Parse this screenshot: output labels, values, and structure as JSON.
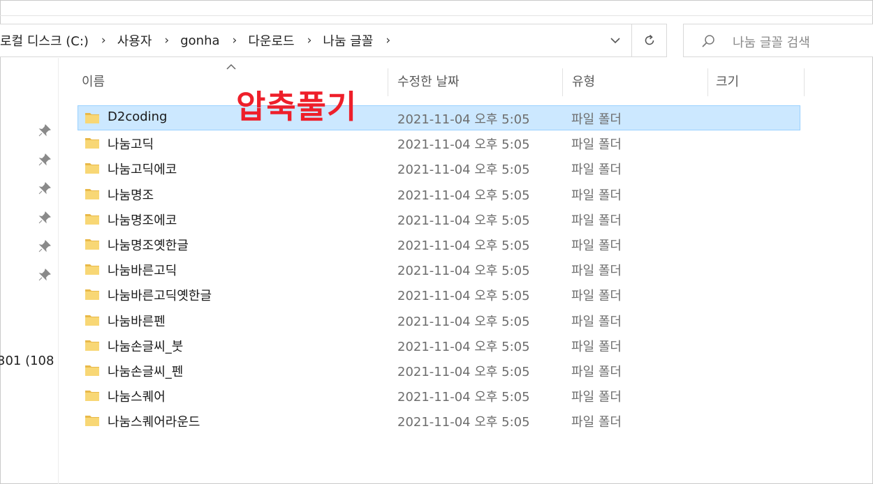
{
  "breadcrumb": {
    "items": [
      "로컬 디스크 (C:)",
      "사용자",
      "gonha",
      "다운로드",
      "나눔 글꼴"
    ]
  },
  "search": {
    "placeholder": "나눔 글꼴 검색"
  },
  "nav": {
    "truncated_item": "301 (108"
  },
  "columns": {
    "name": "이름",
    "date": "수정한 날짜",
    "type": "유형",
    "size": "크기"
  },
  "annotation": "압축풀기",
  "files": [
    {
      "name": "D2coding",
      "date": "2021-11-04 오후 5:05",
      "type": "파일 폴더",
      "selected": true
    },
    {
      "name": "나눔고딕",
      "date": "2021-11-04 오후 5:05",
      "type": "파일 폴더"
    },
    {
      "name": "나눔고딕에코",
      "date": "2021-11-04 오후 5:05",
      "type": "파일 폴더"
    },
    {
      "name": "나눔명조",
      "date": "2021-11-04 오후 5:05",
      "type": "파일 폴더"
    },
    {
      "name": "나눔명조에코",
      "date": "2021-11-04 오후 5:05",
      "type": "파일 폴더"
    },
    {
      "name": "나눔명조옛한글",
      "date": "2021-11-04 오후 5:05",
      "type": "파일 폴더"
    },
    {
      "name": "나눔바른고딕",
      "date": "2021-11-04 오후 5:05",
      "type": "파일 폴더"
    },
    {
      "name": "나눔바른고딕옛한글",
      "date": "2021-11-04 오후 5:05",
      "type": "파일 폴더"
    },
    {
      "name": "나눔바른펜",
      "date": "2021-11-04 오후 5:05",
      "type": "파일 폴더"
    },
    {
      "name": "나눔손글씨_붓",
      "date": "2021-11-04 오후 5:05",
      "type": "파일 폴더"
    },
    {
      "name": "나눔손글씨_펜",
      "date": "2021-11-04 오후 5:05",
      "type": "파일 폴더"
    },
    {
      "name": "나눔스퀘어",
      "date": "2021-11-04 오후 5:05",
      "type": "파일 폴더"
    },
    {
      "name": "나눔스퀘어라운드",
      "date": "2021-11-04 오후 5:05",
      "type": "파일 폴더"
    }
  ],
  "colors": {
    "selection_bg": "#cce8ff",
    "selection_border": "#99d1ff",
    "folder": "#f8d775",
    "annotation": "#ee1f2a"
  }
}
